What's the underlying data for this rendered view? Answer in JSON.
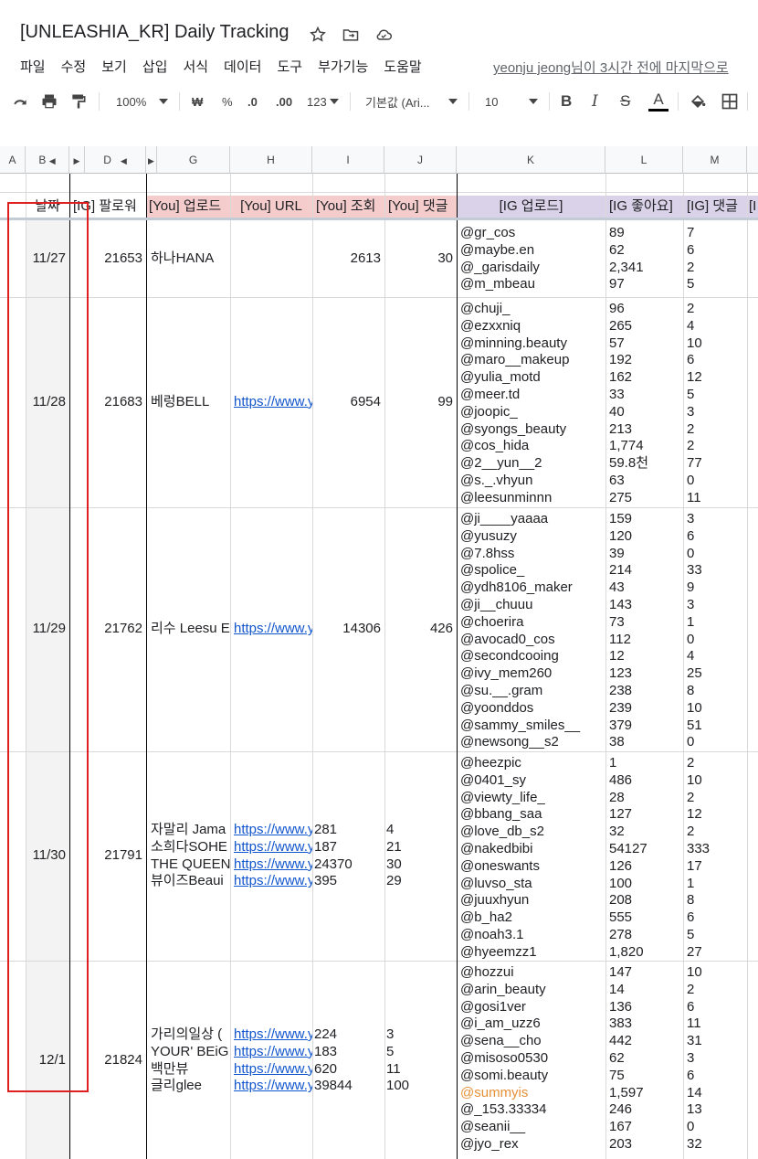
{
  "doc": {
    "title": "[UNLEASHIA_KR] Daily Tracking",
    "last_edit": "yeonju jeong님이 3시간 전에 마지막으로"
  },
  "menu": [
    "파일",
    "수정",
    "보기",
    "삽입",
    "서식",
    "데이터",
    "도구",
    "부가기능",
    "도움말"
  ],
  "toolbar": {
    "zoom": "100%",
    "currency": "₩",
    "percent": "%",
    "dec_decrease": ".0",
    "dec_increase": ".00",
    "number_format": "123",
    "font": "기본값 (Ari...",
    "font_size": "10",
    "bold": "B",
    "italic": "I",
    "strike": "S",
    "text_color": "A"
  },
  "columns": [
    "A",
    "B",
    "D",
    "G",
    "H",
    "I",
    "J",
    "K",
    "L",
    "M"
  ],
  "header": {
    "date": "날짜",
    "ig_followers": "[IG] 팔로워",
    "you_upload": "[You] 업로드",
    "you_url": "[You] URL",
    "you_views": "[You] 조회",
    "you_comments": "[You] 댓글",
    "ig_upload": "[IG 업로드]",
    "ig_likes": "[IG 좋아요]",
    "ig_comments": "[IG] 댓글",
    "overflow": "[I"
  },
  "rows": [
    {
      "date": "11/27",
      "followers": "21653",
      "you_upload": [
        "하나HANA"
      ],
      "you_url": [],
      "you_views": [
        "2613"
      ],
      "you_comments": [
        "30"
      ],
      "you_align": "right",
      "ig": [
        [
          "@gr_cos",
          "89",
          "7"
        ],
        [
          "@maybe.en",
          "62",
          "6"
        ],
        [
          "@_garisdaily",
          "2,341",
          "2"
        ],
        [
          "@m_mbeau",
          "97",
          "5"
        ]
      ]
    },
    {
      "date": "11/28",
      "followers": "21683",
      "you_upload": [
        "베렁BELL"
      ],
      "you_url": [
        "https://www.y"
      ],
      "you_views": [
        "6954"
      ],
      "you_comments": [
        "99"
      ],
      "you_align": "right",
      "ig": [
        [
          "@chuji_",
          "96",
          "2"
        ],
        [
          "@ezxxniq",
          "265",
          "4"
        ],
        [
          "@minning.beauty",
          "57",
          "10"
        ],
        [
          "@maro__makeup",
          "192",
          "6"
        ],
        [
          "@yulia_motd",
          "162",
          "12"
        ],
        [
          "@meer.td",
          "33",
          "5"
        ],
        [
          "@joopic_",
          "40",
          "3"
        ],
        [
          "@syongs_beauty",
          "213",
          "2"
        ],
        [
          "@cos_hida",
          "1,774",
          "2"
        ],
        [
          "@2__yun__2",
          "59.8천",
          "77"
        ],
        [
          "@s._.vhyun",
          "63",
          "0"
        ],
        [
          "@leesunminnn",
          "275",
          "11"
        ]
      ]
    },
    {
      "date": "11/29",
      "followers": "21762",
      "you_upload": [
        "리수 Leesu E"
      ],
      "you_url": [
        "https://www.y"
      ],
      "you_views": [
        "14306"
      ],
      "you_comments": [
        "426"
      ],
      "you_align": "right",
      "ig": [
        [
          "@ji____yaaaa",
          "159",
          "3"
        ],
        [
          "@yusuzy",
          "120",
          "6"
        ],
        [
          "@7.8hss",
          "39",
          "0"
        ],
        [
          "@spolice_",
          "214",
          "33"
        ],
        [
          "@ydh8106_maker",
          "43",
          "9"
        ],
        [
          "@ji__chuuu",
          "143",
          "3"
        ],
        [
          "@choerira",
          "73",
          "1"
        ],
        [
          "@avocad0_cos",
          "112",
          "0"
        ],
        [
          "@secondcooing",
          "12",
          "4"
        ],
        [
          "@ivy_mem260",
          "123",
          "25"
        ],
        [
          "@su.__.gram",
          "238",
          "8"
        ],
        [
          "@yoonddos",
          "239",
          "10"
        ],
        [
          "@sammy_smiles__",
          "379",
          "51"
        ],
        [
          "@newsong__s2",
          "38",
          "0"
        ]
      ]
    },
    {
      "date": "11/30",
      "followers": "21791",
      "you_upload": [
        "자말리 Jama",
        "소희다SOHE",
        "THE QUEEN",
        "뷰이즈Beaui"
      ],
      "you_url": [
        "https://www.y",
        "https://www.y",
        "https://www.y",
        "https://www.y"
      ],
      "you_views": [
        "281",
        "187",
        "24370",
        "395"
      ],
      "you_comments": [
        "4",
        "21",
        "30",
        "29"
      ],
      "you_align": "left",
      "ig": [
        [
          "@heezpic",
          "1",
          "2"
        ],
        [
          "@0401_sy",
          "486",
          "10"
        ],
        [
          "@viewty_life_",
          "28",
          "2"
        ],
        [
          "@bbang_saa",
          "127",
          "12"
        ],
        [
          "@love_db_s2",
          "32",
          "2"
        ],
        [
          "@nakedbibi",
          "54127",
          "333"
        ],
        [
          "@oneswants",
          "126",
          "17"
        ],
        [
          "@luvso_sta",
          "100",
          "1"
        ],
        [
          "@juuxhyun",
          "208",
          "8"
        ],
        [
          "@b_ha2",
          "555",
          "6"
        ],
        [
          "@noah3.1",
          "278",
          "5"
        ],
        [
          "@hyeemzz1",
          "1,820",
          "27"
        ]
      ]
    },
    {
      "date": "12/1",
      "followers": "21824",
      "you_upload": [
        "가리의일상 (",
        "YOUR' BEiG",
        "백만뷰",
        "글리glee"
      ],
      "you_url": [
        "https://www.y",
        "https://www.y",
        "https://www.y",
        "https://www.y"
      ],
      "you_views": [
        "224",
        "183",
        "620",
        "39844"
      ],
      "you_comments": [
        "3",
        "5",
        "11",
        "100"
      ],
      "you_align": "left",
      "ig": [
        [
          "@hozzui",
          "147",
          "10"
        ],
        [
          "@arin_beauty",
          "14",
          "2"
        ],
        [
          "@gosi1ver",
          "136",
          "6"
        ],
        [
          "@i_am_uzz6",
          "383",
          "11"
        ],
        [
          "@sena__cho",
          "442",
          "31"
        ],
        [
          "@misoso0530",
          "62",
          "3"
        ],
        [
          "@somi.beauty",
          "75",
          "6"
        ],
        [
          "@summyis",
          "1,597",
          "14"
        ],
        [
          "@_153.33334",
          "246",
          "13"
        ],
        [
          "@seanii__",
          "167",
          "0"
        ],
        [
          "@jyo_rex",
          "203",
          "32"
        ]
      ]
    }
  ],
  "colors": {
    "header_pink": "#f4cccc",
    "header_lavender": "#d9d2e9",
    "link": "#1155cc",
    "highlight_orange": "#e69138",
    "annotation_red": "#e02020"
  }
}
